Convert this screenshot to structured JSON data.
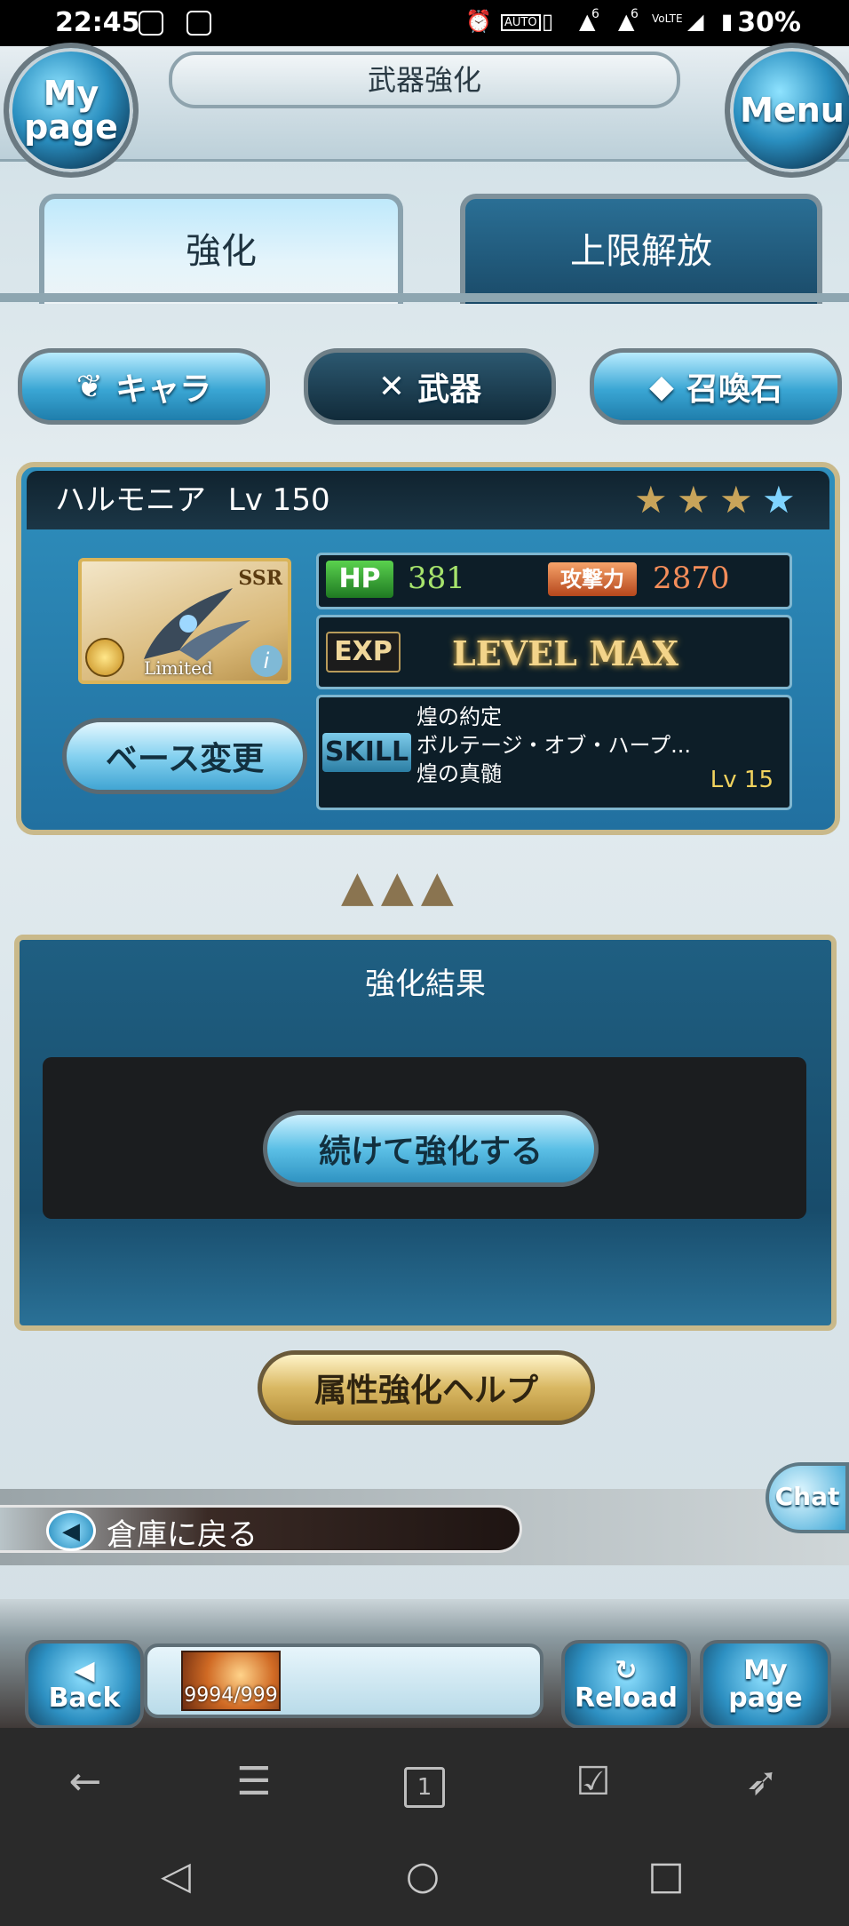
{
  "status_bar": {
    "time": "22:45",
    "battery": "30%",
    "icons": [
      "chat-bubble-icon",
      "image-icon",
      "alarm-icon",
      "auto-hz-icon",
      "vibrate-icon",
      "signal-6-icon",
      "signal-6-icon",
      "volte-icon",
      "cell-signal-icon",
      "battery-icon"
    ],
    "auto_label": "AUTO",
    "signal_label": "6",
    "volte_label": "VoLTE"
  },
  "header": {
    "title": "武器強化",
    "mypage_line1": "My",
    "mypage_line2": "page",
    "menu_label": "Menu"
  },
  "tabs": [
    {
      "label": "強化",
      "active": true
    },
    {
      "label": "上限解放",
      "active": false
    }
  ],
  "categories": [
    {
      "label": "キャラ",
      "icon": "wing-icon",
      "active": false
    },
    {
      "label": "武器",
      "icon": "crossed-swords-icon",
      "active": true
    },
    {
      "label": "召喚石",
      "icon": "crystal-icon",
      "active": false
    }
  ],
  "weapon": {
    "name": "ハルモニア",
    "level_label": "Lv 150",
    "stars_filled": 3,
    "stars_total": 4,
    "rarity": "SSR",
    "limited_label": "Limited",
    "info_label": "i",
    "hp_label": "HP",
    "hp_value": "381",
    "atk_label": "攻撃力",
    "atk_value": "2870",
    "exp_label": "EXP",
    "exp_value": "LEVEL MAX",
    "skill_label": "SKILL",
    "skills": [
      "煌の約定",
      "ボルテージ・オブ・ハープ...",
      "煌の真髄"
    ],
    "skill_level": "Lv 15",
    "base_change_label": "ベース変更"
  },
  "result": {
    "title": "強化結果",
    "continue_label": "続けて強化する"
  },
  "help_label": "属性強化ヘルプ",
  "storage": {
    "label": "倉庫に戻る",
    "arrow": "◀"
  },
  "chat_label": "Chat",
  "bottom_bar": {
    "back_label": "Back",
    "back_arrow": "◀",
    "item_count": "9994/999",
    "reload_label": "Reload",
    "reload_icon": "↻",
    "mypage_line1": "My",
    "mypage_line2": "page"
  },
  "browser_bar": {
    "icons": [
      "back-arrow-icon",
      "menu-icon",
      "tabs-icon",
      "checkbox-icon",
      "rocket-icon"
    ],
    "tab_count": "1"
  },
  "nav_bar": {
    "icons": [
      "nav-back-icon",
      "nav-home-icon",
      "nav-recents-icon"
    ]
  }
}
